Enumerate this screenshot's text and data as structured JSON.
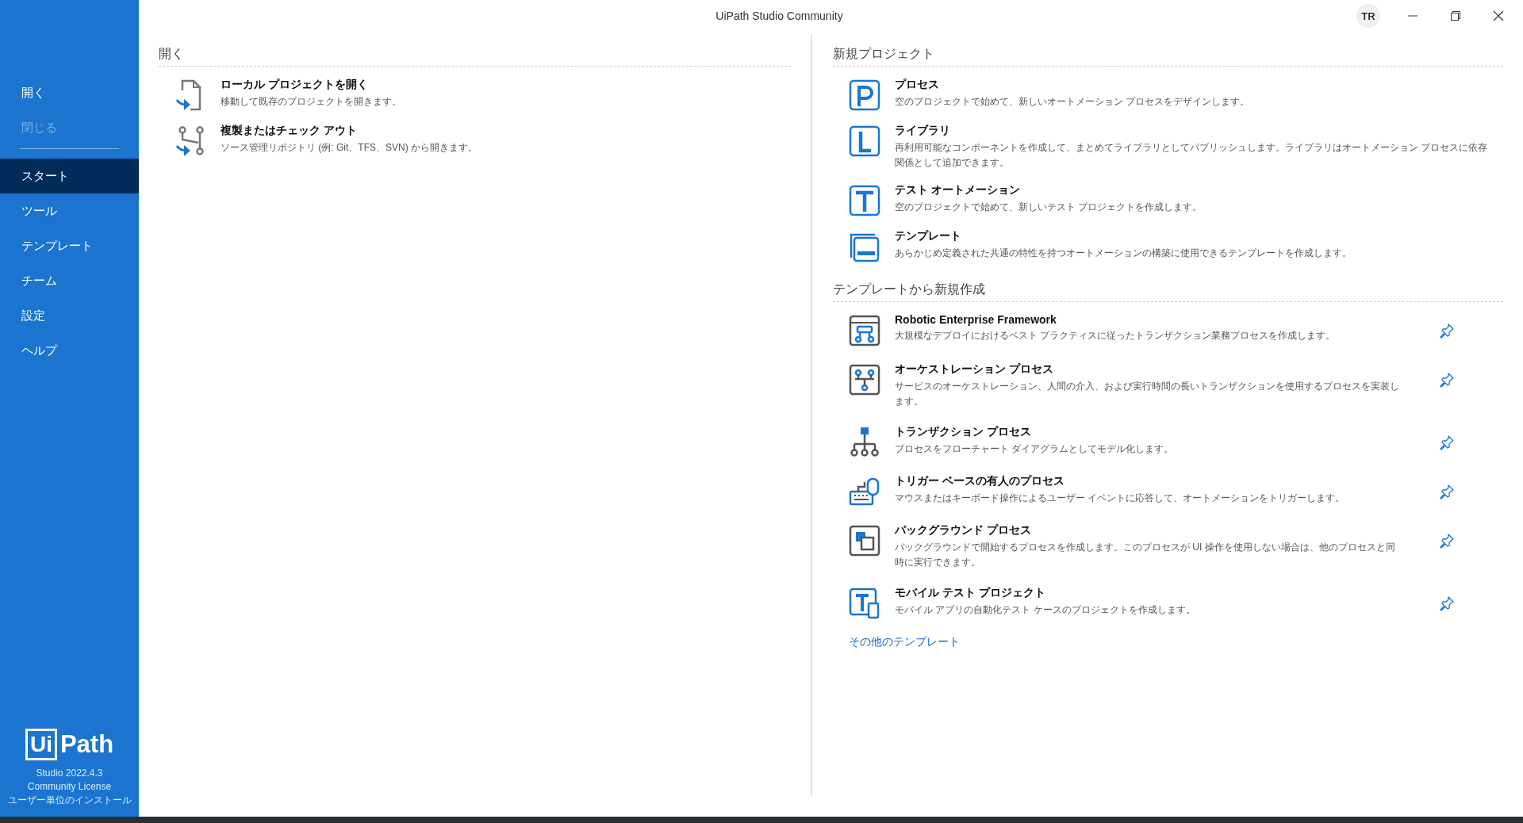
{
  "window": {
    "title": "UiPath Studio Community",
    "user_initials": "TR"
  },
  "sidebar": {
    "items": [
      {
        "label": "開く",
        "selected": false,
        "disabled": false
      },
      {
        "label": "閉じる",
        "selected": false,
        "disabled": true
      },
      {
        "label": "スタート",
        "selected": true,
        "disabled": false
      },
      {
        "label": "ツール",
        "selected": false,
        "disabled": false
      },
      {
        "label": "テンプレート",
        "selected": false,
        "disabled": false
      },
      {
        "label": "チーム",
        "selected": false,
        "disabled": false
      },
      {
        "label": "設定",
        "selected": false,
        "disabled": false
      },
      {
        "label": "ヘルプ",
        "selected": false,
        "disabled": false
      }
    ],
    "logo": {
      "left": "Ui",
      "right": "Path"
    },
    "version_lines": [
      "Studio 2022.4.3",
      "Community License",
      "ユーザー単位のインストール"
    ]
  },
  "open_section": {
    "heading": "開く",
    "items": [
      {
        "title": "ローカル プロジェクトを開く",
        "description": "移動して既存のプロジェクトを開きます。"
      },
      {
        "title": "複製またはチェック アウト",
        "description": "ソース管理リポジトリ (例: Git、TFS、SVN) から開きます。"
      }
    ]
  },
  "new_project": {
    "heading": "新規プロジェクト",
    "items": [
      {
        "title": "プロセス",
        "description": "空のプロジェクトで始めて、新しいオートメーション プロセスをデザインします。"
      },
      {
        "title": "ライブラリ",
        "description": "再利用可能なコンポーネントを作成して、まとめてライブラリとしてパブリッシュします。ライブラリはオートメーション プロセスに依存関係として追加できます。"
      },
      {
        "title": "テスト オートメーション",
        "description": "空のプロジェクトで始めて、新しいテスト プロジェクトを作成します。"
      },
      {
        "title": "テンプレート",
        "description": "あらかじめ定義された共通の特性を持つオートメーションの構築に使用できるテンプレートを作成します。"
      }
    ]
  },
  "from_template": {
    "heading": "テンプレートから新規作成",
    "items": [
      {
        "title": "Robotic Enterprise Framework",
        "description": "大規模なデプロイにおけるベスト プラクティスに従ったトランザクション業務プロセスを作成します。"
      },
      {
        "title": "オーケストレーション プロセス",
        "description": "サービスのオーケストレーション、人間の介入、および実行時間の長いトランザクションを使用するプロセスを実装します。"
      },
      {
        "title": "トランザクション プロセス",
        "description": "プロセスをフローチャート ダイアグラムとしてモデル化します。"
      },
      {
        "title": "トリガー ベースの有人のプロセス",
        "description": "マウスまたはキーボード操作によるユーザー イベントに応答して、オートメーションをトリガーします。"
      },
      {
        "title": "バックグラウンド プロセス",
        "description": "バックグラウンドで開始するプロセスを作成します。このプロセスが UI 操作を使用しない場合は、他のプロセスと同時に実行できます。"
      },
      {
        "title": "モバイル テスト プロジェクト",
        "description": "モバイル アプリの自動化テスト ケースのプロジェクトを作成します。"
      }
    ],
    "more_link": "その他のテンプレート"
  }
}
